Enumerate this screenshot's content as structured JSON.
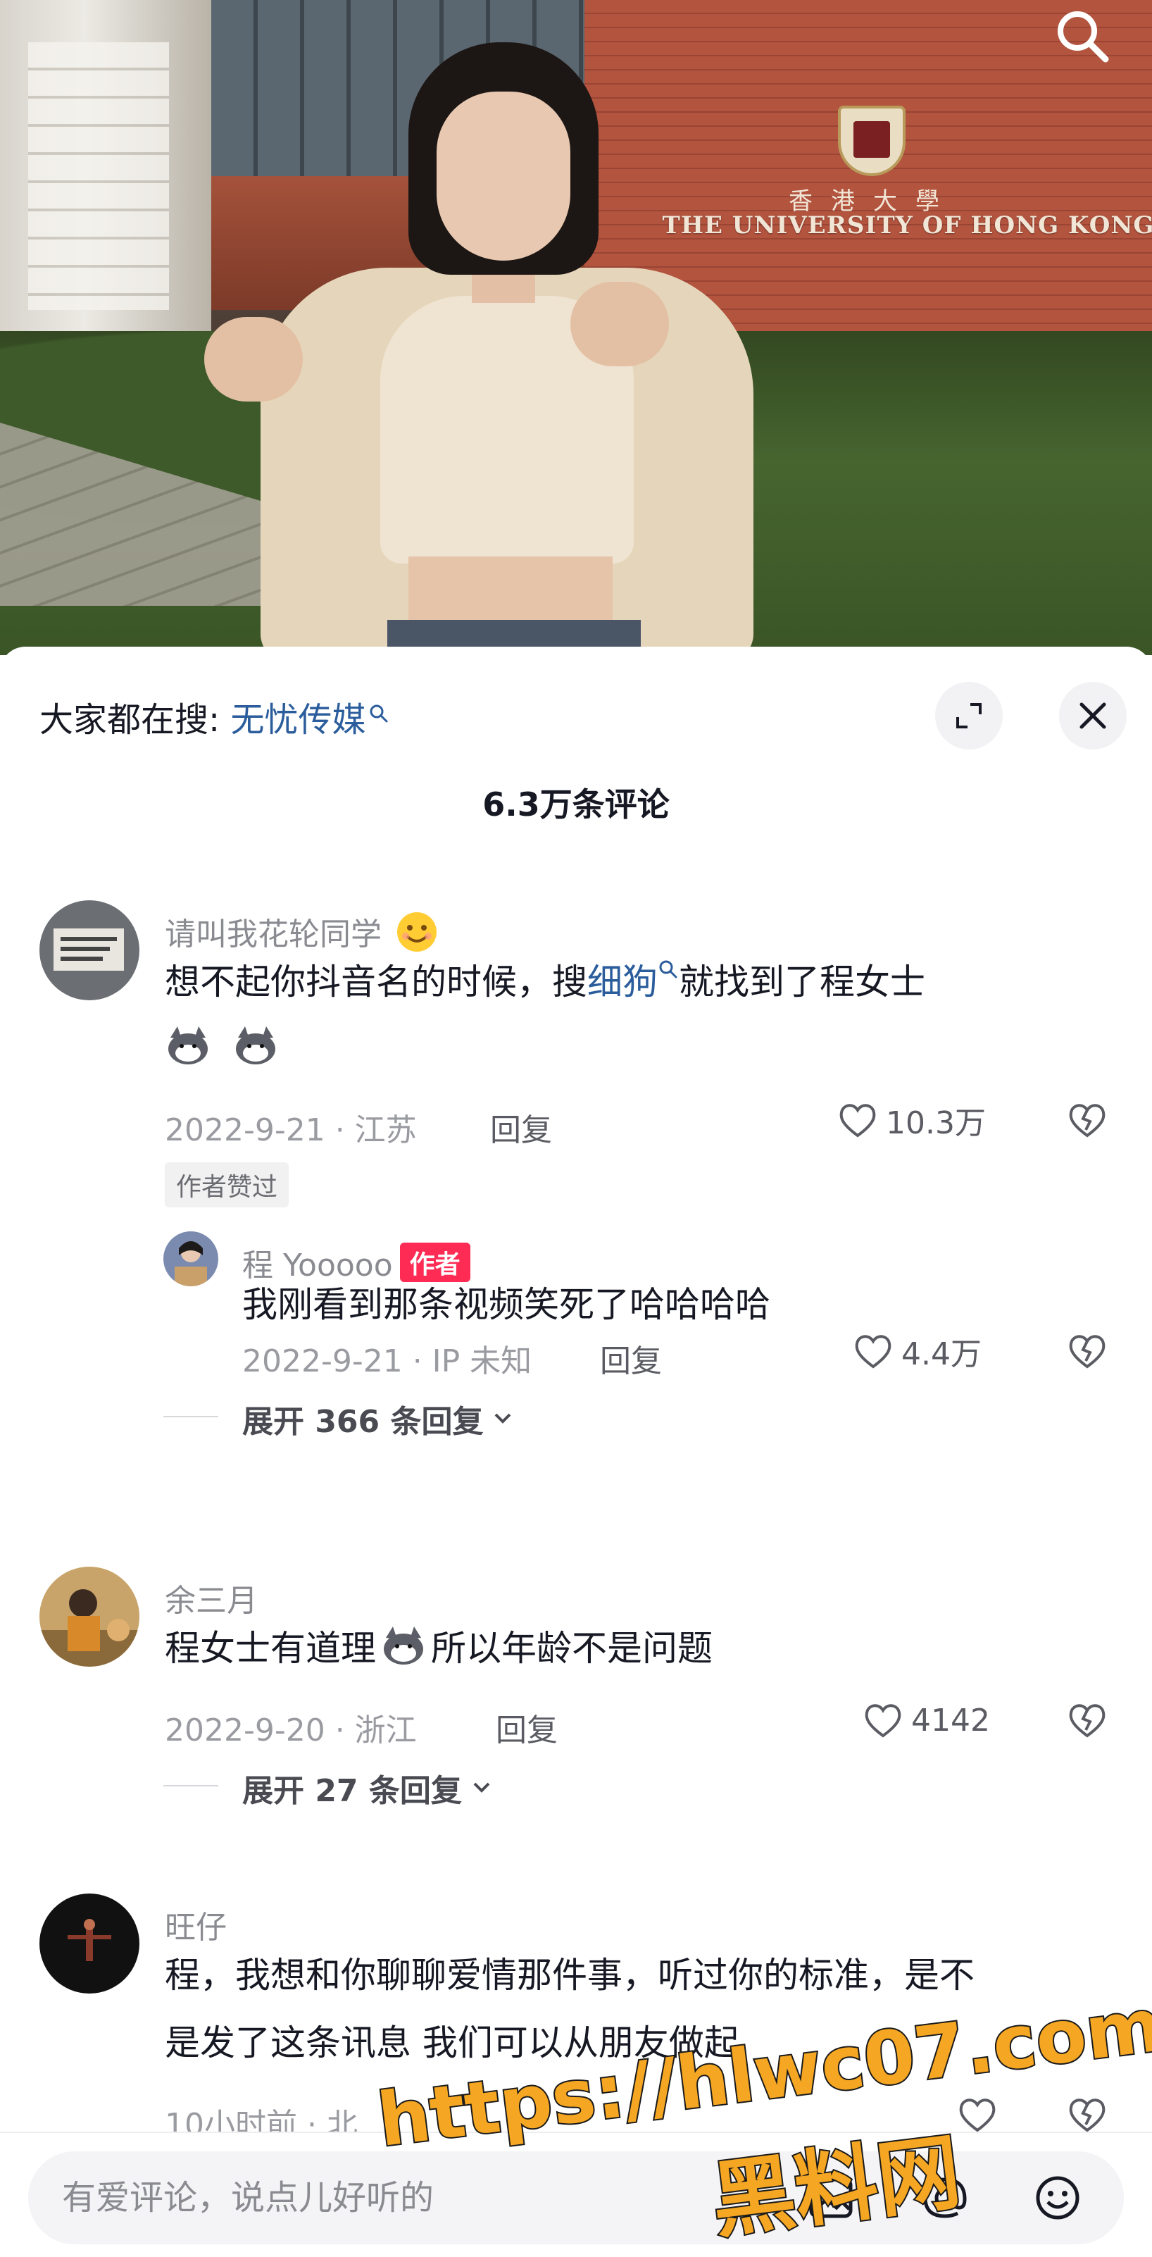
{
  "video": {
    "sign_en": "THE UNIVERSITY OF HONG KONG",
    "sign_cn": "香港大學"
  },
  "hot_search": {
    "prefix": "大家都在搜:",
    "keyword": "无忧传媒"
  },
  "comment_count": "6.3万条评论",
  "comments": [
    {
      "user": "请叫我花轮同学",
      "text_a": "想不起你抖音名的时候，搜",
      "text_kw": "细狗",
      "text_b": "就找到了程女士",
      "meta": "2022-9-21 · 江苏",
      "reply_label": "回复",
      "likes": "10.3万",
      "badge": "作者赞过",
      "sub_reply": {
        "user": "程 Yooooo",
        "tag": "作者",
        "text": "我刚看到那条视频笑死了哈哈哈哈",
        "meta": "2022-9-21 · IP 未知",
        "reply_label": "回复",
        "likes": "4.4万"
      },
      "expand": "展开 366 条回复"
    },
    {
      "user": "余三月",
      "text_a": "程女士有道理",
      "text_b": "所以年龄不是问题",
      "meta": "2022-9-20 · 浙江",
      "reply_label": "回复",
      "likes": "4142",
      "expand": "展开 27 条回复"
    },
    {
      "user": "旺仔",
      "text_line1": "程，我想和你聊聊爱情那件事，听过你的标准，是不",
      "text_line2": "是发了这条讯息 我们可以从朋友做起",
      "meta": "10小时前 · 北"
    }
  ],
  "input": {
    "placeholder": "有爱评论，说点儿好听的"
  },
  "watermark": {
    "url": "https://hlwc07.com",
    "name": "黑料网"
  },
  "colors": {
    "accent_link": "#2b5d9c",
    "author_tag": "#fe2c55",
    "watermark": "#f5a623"
  },
  "icons": [
    "search-icon",
    "expand-icon",
    "close-icon",
    "heart-icon",
    "dislike-icon",
    "chevron-down-icon",
    "image-icon",
    "at-icon",
    "emoji-icon"
  ]
}
